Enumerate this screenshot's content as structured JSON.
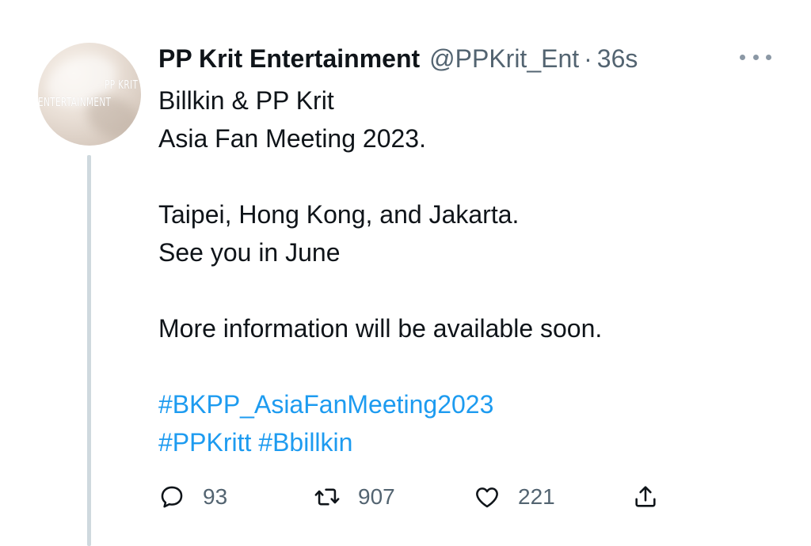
{
  "author": {
    "display_name": "PP Krit Entertainment",
    "handle": "@PPKrit_Ent",
    "separator": "·",
    "time": "36s",
    "avatar_text_line1": "PP KRIT",
    "avatar_text_line2": "ENTERTAINMENT"
  },
  "tweet": {
    "lines": [
      "Billkin & PP Krit",
      "Asia Fan Meeting 2023.",
      "",
      "Taipei, Hong Kong, and Jakarta.",
      "See you in June",
      "",
      "More information will be available soon.",
      ""
    ],
    "hashtag_line1": "#BKPP_AsiaFanMeeting2023",
    "hashtag_line2a": "#PPKritt",
    "hashtag_line2b": "#Bbillkin"
  },
  "actions": {
    "reply_count": "93",
    "retweet_count": "907",
    "like_count": "221"
  },
  "colors": {
    "link": "#1d9bf0",
    "muted": "#536471",
    "thread_line": "#cfd9de"
  },
  "icons": {
    "reply": "reply-icon",
    "retweet": "retweet-icon",
    "like": "heart-icon",
    "share": "share-icon",
    "more": "more-icon"
  }
}
